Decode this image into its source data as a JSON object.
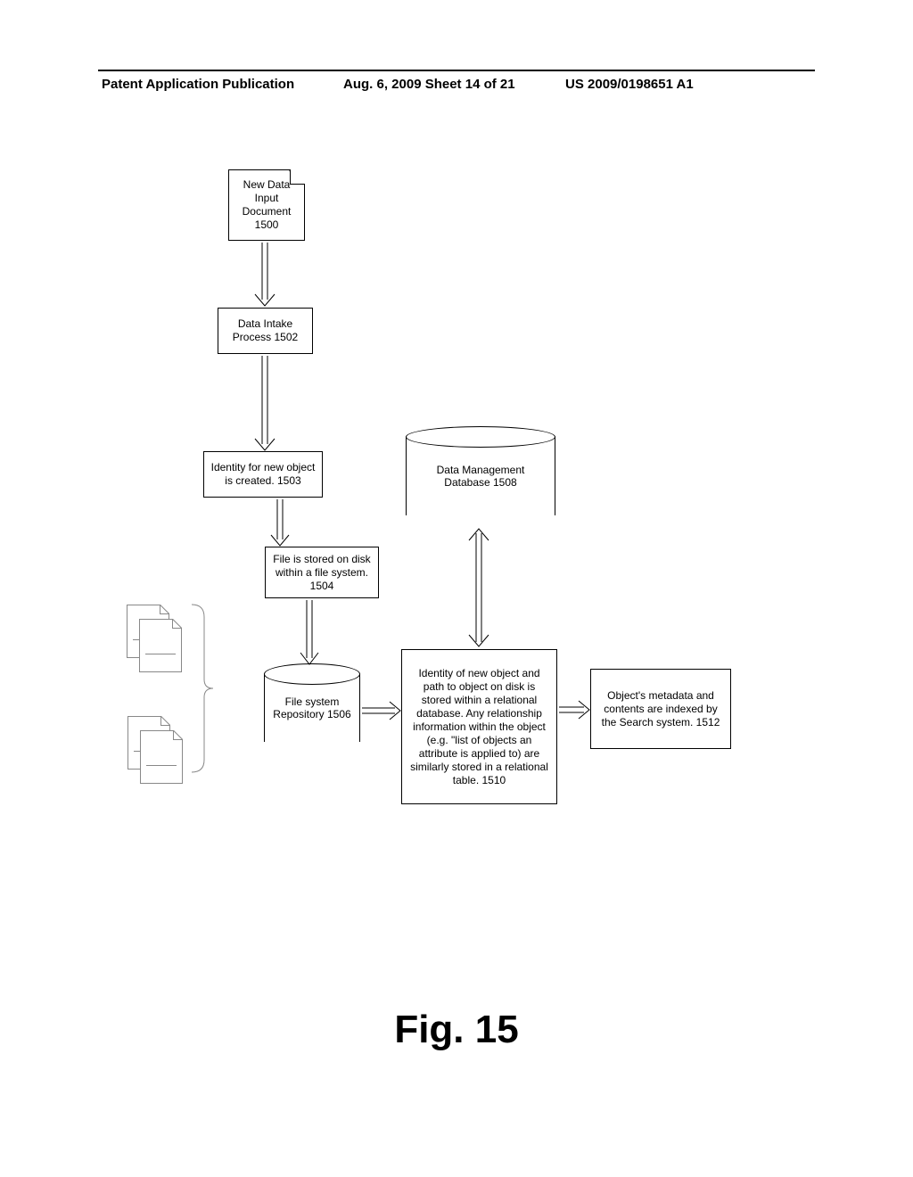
{
  "header": {
    "left": "Patent Application Publication",
    "center": "Aug. 6, 2009  Sheet 14 of 21",
    "right": "US 2009/0198651 A1"
  },
  "nodes": {
    "n1500": "New Data Input Document 1500",
    "n1502": "Data Intake Process 1502",
    "n1503": "Identity for new object is created. 1503",
    "n1504": "File is stored on disk within a file system. 1504",
    "n1506": "File system Repository 1506",
    "n1508": "Data Management Database 1508",
    "n1510": "Identity of new object and path to object on disk is stored within a relational database.  Any relationship information within the object (e.g. \"list of objects an attribute is applied to) are similarly stored in a relational table. 1510",
    "n1512": "Object's metadata and contents are indexed by the Search system. 1512"
  },
  "figure_caption": "Fig. 15"
}
